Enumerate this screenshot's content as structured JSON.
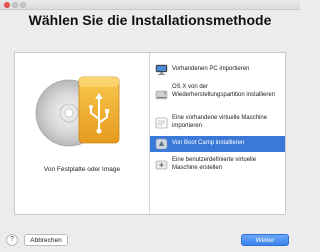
{
  "window": {
    "title": ""
  },
  "heading": "Wählen Sie die Installationsmethode",
  "left_panel": {
    "label": "Von Festplatte oder Image"
  },
  "options": [
    {
      "label": "Vorhandenen PC importieren",
      "icon": "pc-import-icon",
      "selected": false
    },
    {
      "label": "OS X von der Wiederherstellungspartition installieren",
      "icon": "disk-drive-icon",
      "selected": false
    },
    {
      "label": "Eine vorhandene virtuelle Maschine importieren",
      "icon": "vm-import-icon",
      "selected": false
    },
    {
      "label": "Von Boot Camp installieren",
      "icon": "boot-camp-icon",
      "selected": true
    },
    {
      "label": "Eine benutzerdefinierte virtuelle Maschine erstellen",
      "icon": "custom-vm-icon",
      "selected": false
    }
  ],
  "buttons": {
    "help": "?",
    "cancel": "Abbrechen",
    "next": "Weiter"
  },
  "colors": {
    "selection": "#3b79d8",
    "primary_button": "#3d83ee",
    "close": "#ee5a53"
  }
}
